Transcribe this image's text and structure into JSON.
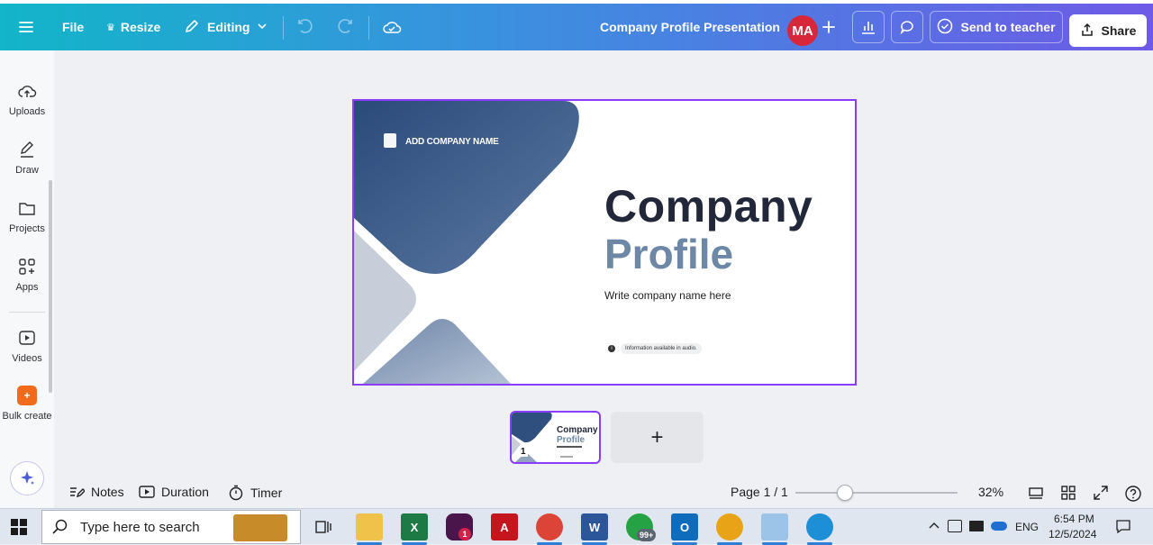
{
  "topbar": {
    "file_label": "File",
    "resize_label": "Resize",
    "editing_label": "Editing",
    "doc_title": "Company Profile Presentation",
    "avatar_initials": "MA",
    "send_label": "Send to teacher",
    "share_label": "Share"
  },
  "sidebar": {
    "items": [
      {
        "label": "Uploads",
        "icon": "upload-cloud-icon"
      },
      {
        "label": "Draw",
        "icon": "pen-icon"
      },
      {
        "label": "Projects",
        "icon": "folder-icon"
      },
      {
        "label": "Apps",
        "icon": "apps-grid-icon"
      },
      {
        "label": "Videos",
        "icon": "video-play-icon"
      },
      {
        "label": "Bulk create",
        "icon": "bulk-create-icon"
      }
    ]
  },
  "slide": {
    "company_name": "ADD COMPANY NAME",
    "title_line1": "Company",
    "title_line2": "Profile",
    "subtitle": "Write company name here",
    "info_text": "Information available in audio.",
    "colors": {
      "dark_blue": "#22406e",
      "accent": "#6d87a6",
      "light": "#c7ceda"
    }
  },
  "thumbnails": {
    "page_number": "1",
    "thumb_title1": "Company",
    "thumb_title2": "Profile",
    "add_label": "+"
  },
  "bottombar": {
    "notes_label": "Notes",
    "duration_label": "Duration",
    "timer_label": "Timer",
    "page_label": "Page 1 / 1",
    "zoom_label": "32%",
    "zoom_fraction": 0.3
  },
  "taskbar": {
    "search_placeholder": "Type here to search",
    "lang": "ENG",
    "time": "6:54 PM",
    "date": "12/5/2024",
    "badges": {
      "slack": "1",
      "whatsapp": "99+"
    }
  },
  "theme": {
    "accent_purple": "#8b3dff",
    "brand_gradient_start": "#12b5c9",
    "brand_gradient_end": "#6e5ae6"
  }
}
